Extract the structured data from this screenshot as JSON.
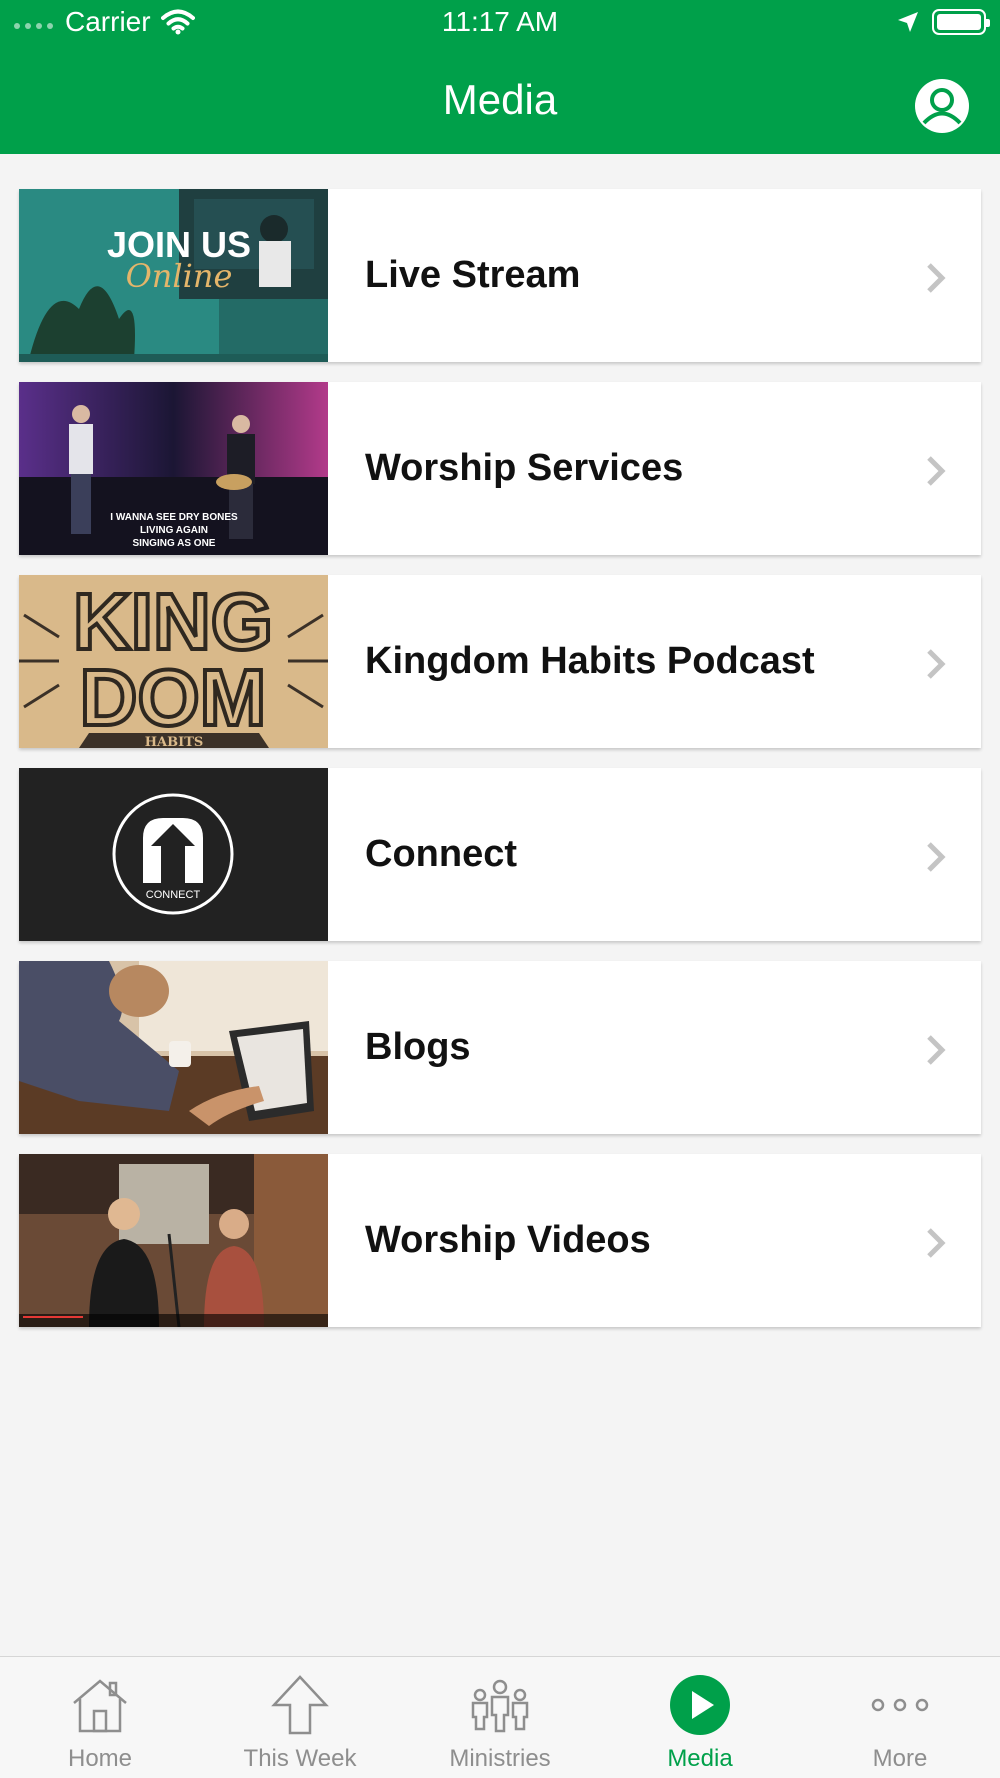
{
  "status_bar": {
    "carrier": "Carrier",
    "time": "11:17 AM"
  },
  "header": {
    "title": "Media"
  },
  "colors": {
    "brand": "#00a04a",
    "background": "#f4f4f4",
    "tab_inactive": "#8e8e8e"
  },
  "media_items": [
    {
      "label": "Live Stream",
      "thumb_text_1": "JOIN US",
      "thumb_text_2": "Online"
    },
    {
      "label": "Worship Services",
      "caption_1": "I WANNA SEE DRY BONES",
      "caption_2": "LIVING AGAIN",
      "caption_3": "SINGING AS ONE"
    },
    {
      "label": "Kingdom Habits Podcast",
      "thumb_text_1": "KING",
      "thumb_text_2": "DOM",
      "thumb_text_3": "HABITS"
    },
    {
      "label": "Connect",
      "thumb_text_1": "CONNECT"
    },
    {
      "label": "Blogs"
    },
    {
      "label": "Worship Videos"
    }
  ],
  "tabs": [
    {
      "label": "Home",
      "icon": "home-icon"
    },
    {
      "label": "This Week",
      "icon": "arrow-up-icon"
    },
    {
      "label": "Ministries",
      "icon": "people-icon"
    },
    {
      "label": "Media",
      "icon": "play-icon",
      "active": true
    },
    {
      "label": "More",
      "icon": "more-icon"
    }
  ]
}
